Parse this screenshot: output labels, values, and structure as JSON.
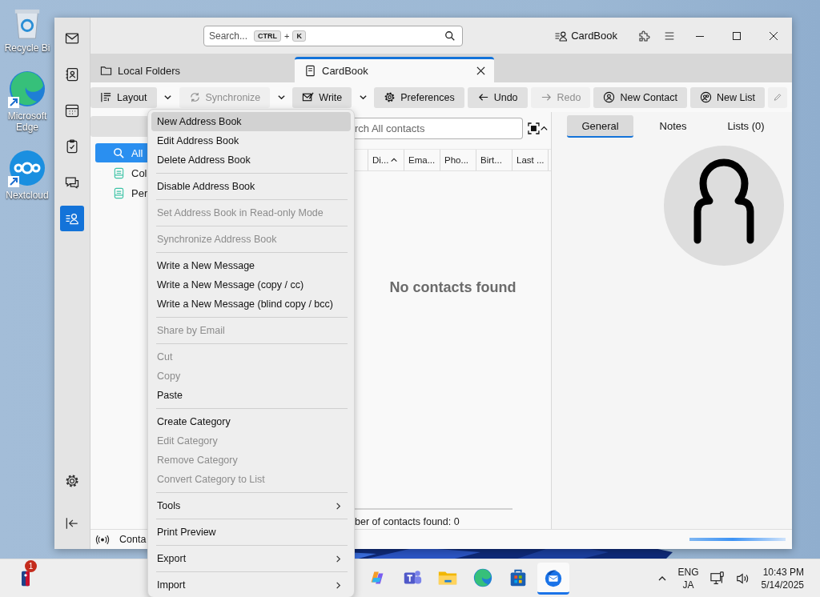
{
  "desktop_icons": [
    {
      "label": "Recycle Bi",
      "kind": "bin"
    },
    {
      "label": "Microsoft Edge",
      "kind": "browser"
    },
    {
      "label": "Nextcloud",
      "kind": "rings"
    }
  ],
  "spaces": [
    {
      "kind": "mail",
      "selected": false
    },
    {
      "kind": "addressbook",
      "selected": false
    },
    {
      "kind": "calendar",
      "selected": false
    },
    {
      "kind": "tasks",
      "selected": false
    },
    {
      "kind": "chat",
      "selected": false
    },
    {
      "kind": "cardbook",
      "selected": true
    }
  ],
  "title_bar": {
    "search_placeholder": "Search...",
    "keys": [
      "CTRL",
      "+",
      "K"
    ],
    "app_button": "CardBook"
  },
  "tabs": [
    {
      "label": "Local Folders",
      "kind": "folder",
      "selected": false
    },
    {
      "label": "CardBook",
      "kind": "book",
      "selected": true
    }
  ],
  "toolbar": [
    {
      "label": "Layout",
      "kind": "layout",
      "disabled": false,
      "dropdown": true
    },
    {
      "label": "Synchronize",
      "kind": "sync",
      "disabled": true,
      "dropdown": true
    },
    {
      "label": "Write",
      "kind": "write",
      "disabled": false,
      "dropdown": true
    },
    {
      "label": "Preferences",
      "kind": "gear",
      "disabled": false,
      "dropdown": false
    },
    {
      "label": "Undo",
      "kind": "undo",
      "disabled": false,
      "dropdown": false
    },
    {
      "label": "Redo",
      "kind": "redo",
      "disabled": true,
      "dropdown": false
    },
    {
      "label": "New Contact",
      "kind": "contact",
      "disabled": false,
      "dropdown": false
    },
    {
      "label": "New List",
      "kind": "list",
      "disabled": false,
      "dropdown": false
    },
    {
      "kind": "edit",
      "disabled": true,
      "dropdown": false
    }
  ],
  "folders": [
    {
      "label": "All",
      "kind": "search",
      "selected": true
    },
    {
      "label": "Col",
      "kind": "book",
      "selected": false
    },
    {
      "label": "Per",
      "kind": "book",
      "selected": false
    }
  ],
  "contacts": {
    "search_placeholder": "rch All contacts",
    "columns": [
      {
        "label": "Di...",
        "sorted": true
      },
      {
        "label": "Ema...",
        "sorted": false
      },
      {
        "label": "Pho...",
        "sorted": false
      },
      {
        "label": "Birt...",
        "sorted": false
      },
      {
        "label": "Last ...",
        "sorted": false
      }
    ],
    "empty_message": "No contacts found",
    "count": "ber of contacts found: 0"
  },
  "details": {
    "tabs": [
      {
        "label": "General",
        "selected": true
      },
      {
        "label": "Notes",
        "selected": false
      },
      {
        "label": "Lists (0)",
        "selected": false
      }
    ]
  },
  "status_bar": {
    "text": "Conta"
  },
  "context_menu": [
    {
      "kind": "item",
      "label": "New Address Book",
      "disabled": false,
      "highlighted": true,
      "submenu": false
    },
    {
      "kind": "item",
      "label": "Edit Address Book",
      "disabled": false,
      "highlighted": false,
      "submenu": false
    },
    {
      "kind": "item",
      "label": "Delete Address Book",
      "disabled": false,
      "highlighted": false,
      "submenu": false
    },
    {
      "kind": "separator"
    },
    {
      "kind": "item",
      "label": "Disable Address Book",
      "disabled": false,
      "highlighted": false,
      "submenu": false
    },
    {
      "kind": "separator"
    },
    {
      "kind": "item",
      "label": "Set Address Book in Read-only Mode",
      "disabled": true,
      "highlighted": false,
      "submenu": false
    },
    {
      "kind": "separator"
    },
    {
      "kind": "item",
      "label": "Synchronize Address Book",
      "disabled": true,
      "highlighted": false,
      "submenu": false
    },
    {
      "kind": "separator"
    },
    {
      "kind": "item",
      "label": "Write a New Message",
      "disabled": false,
      "highlighted": false,
      "submenu": false
    },
    {
      "kind": "item",
      "label": "Write a New Message (copy / cc)",
      "disabled": false,
      "highlighted": false,
      "submenu": false
    },
    {
      "kind": "item",
      "label": "Write a New Message (blind copy / bcc)",
      "disabled": false,
      "highlighted": false,
      "submenu": false
    },
    {
      "kind": "separator"
    },
    {
      "kind": "item",
      "label": "Share by Email",
      "disabled": true,
      "highlighted": false,
      "submenu": false
    },
    {
      "kind": "separator"
    },
    {
      "kind": "item",
      "label": "Cut",
      "disabled": true,
      "highlighted": false,
      "submenu": false
    },
    {
      "kind": "item",
      "label": "Copy",
      "disabled": true,
      "highlighted": false,
      "submenu": false
    },
    {
      "kind": "item",
      "label": "Paste",
      "disabled": false,
      "highlighted": false,
      "submenu": false
    },
    {
      "kind": "separator"
    },
    {
      "kind": "item",
      "label": "Create Category",
      "disabled": false,
      "highlighted": false,
      "submenu": false
    },
    {
      "kind": "item",
      "label": "Edit Category",
      "disabled": true,
      "highlighted": false,
      "submenu": false
    },
    {
      "kind": "item",
      "label": "Remove Category",
      "disabled": true,
      "highlighted": false,
      "submenu": false
    },
    {
      "kind": "item",
      "label": "Convert Category to List",
      "disabled": true,
      "highlighted": false,
      "submenu": false
    },
    {
      "kind": "separator"
    },
    {
      "kind": "item",
      "label": "Tools",
      "disabled": false,
      "highlighted": false,
      "submenu": true
    },
    {
      "kind": "separator"
    },
    {
      "kind": "item",
      "label": "Print Preview",
      "disabled": false,
      "highlighted": false,
      "submenu": false
    },
    {
      "kind": "separator"
    },
    {
      "kind": "item",
      "label": "Export",
      "disabled": false,
      "highlighted": false,
      "submenu": true
    },
    {
      "kind": "separator"
    },
    {
      "kind": "item",
      "label": "Import",
      "disabled": false,
      "highlighted": false,
      "submenu": true
    }
  ],
  "taskbar": {
    "badge": "1",
    "apps": [
      {
        "kind": "copilot",
        "active": false
      },
      {
        "kind": "teams",
        "active": false
      },
      {
        "kind": "files",
        "active": false
      },
      {
        "kind": "browser",
        "active": false
      },
      {
        "kind": "store",
        "active": false
      },
      {
        "kind": "mail",
        "active": true
      }
    ],
    "language": "ENG",
    "layout": "JA",
    "time": "10:43 PM",
    "date": "5/14/2025"
  }
}
